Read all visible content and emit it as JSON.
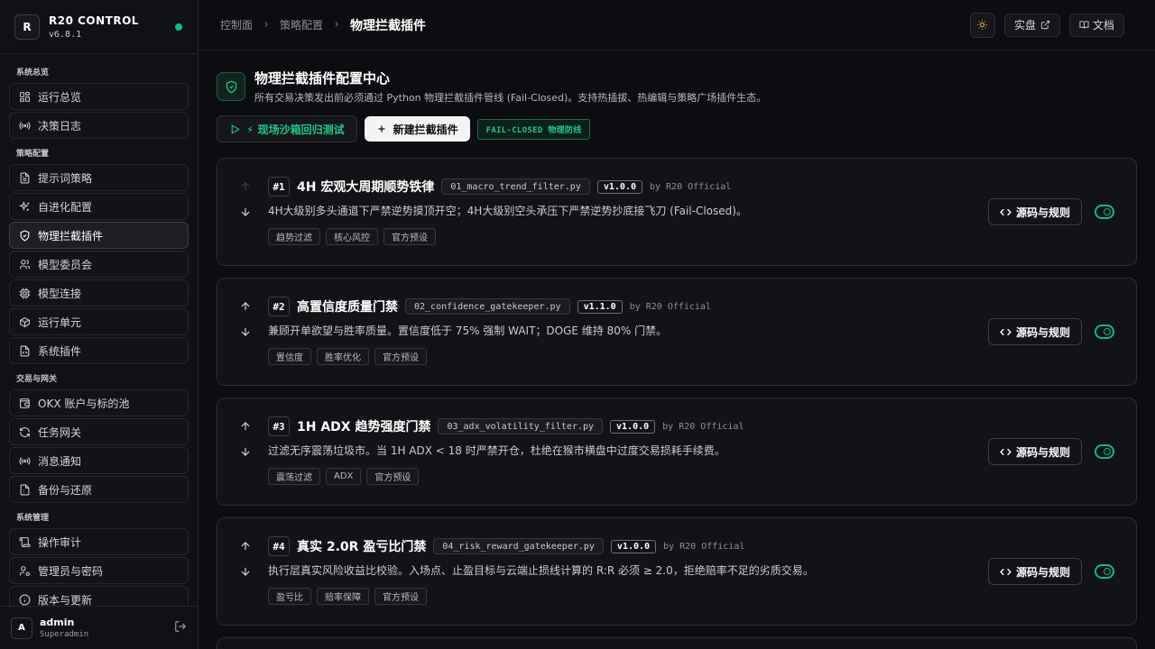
{
  "brand": {
    "logo": "R",
    "title": "R20 CONTROL",
    "version": "v6.8.1",
    "status_color": "#10b981"
  },
  "sidebar": {
    "sections": [
      {
        "title": "系统总览",
        "items": [
          {
            "label": "运行总览",
            "icon": "dashboard-icon"
          },
          {
            "label": "决策日志",
            "icon": "broadcast-icon"
          }
        ]
      },
      {
        "title": "策略配置",
        "items": [
          {
            "label": "提示词策略",
            "icon": "document-icon"
          },
          {
            "label": "自进化配置",
            "icon": "sparkles-icon"
          },
          {
            "label": "物理拦截插件",
            "icon": "shield-icon",
            "active": true
          },
          {
            "label": "模型委员会",
            "icon": "users-icon"
          },
          {
            "label": "模型连接",
            "icon": "cpu-icon"
          },
          {
            "label": "运行单元",
            "icon": "box-icon"
          },
          {
            "label": "系统插件",
            "icon": "file-code-icon"
          }
        ]
      },
      {
        "title": "交易与网关",
        "items": [
          {
            "label": "OKX 账户与标的池",
            "icon": "wallet-icon"
          },
          {
            "label": "任务网关",
            "icon": "refresh-icon"
          },
          {
            "label": "消息通知",
            "icon": "broadcast-icon"
          },
          {
            "label": "备份与还原",
            "icon": "file-archive-icon"
          }
        ]
      },
      {
        "title": "系统管理",
        "items": [
          {
            "label": "操作审计",
            "icon": "scroll-icon"
          },
          {
            "label": "管理员与密码",
            "icon": "user-gear-icon"
          },
          {
            "label": "版本与更新",
            "icon": "info-icon"
          }
        ]
      }
    ],
    "user": {
      "avatar": "A",
      "name": "admin",
      "role": "Superadmin"
    }
  },
  "header": {
    "breadcrumbs": [
      "控制面",
      "策略配置",
      "物理拦截插件"
    ],
    "live_label": "实盘",
    "docs_label": "文档"
  },
  "page": {
    "title": "物理拦截插件配置中心",
    "subtitle": "所有交易决策发出前必须通过 Python 物理拦截插件管线 (Fail-Closed)。支持热插拔、热编辑与策略广场插件生态。",
    "sandbox_label": "⚡ 现场沙箱回归测试",
    "new_label": "新建拦截插件",
    "badge": "FAIL-CLOSED 物理防线",
    "accent": "#22c587"
  },
  "plugins": [
    {
      "index": "#1",
      "name": "4H 宏观大周期顺势铁律",
      "file": "01_macro_trend_filter.py",
      "version": "v1.0.0",
      "author": "by R20 Official",
      "desc": "4H大级别多头通道下严禁逆势摸顶开空；4H大级别空头承压下严禁逆势抄底接飞刀 (Fail-Closed)。",
      "tags": [
        "趋势过滤",
        "核心风控",
        "官方预设"
      ],
      "source_label": "源码与规则",
      "enabled": true
    },
    {
      "index": "#2",
      "name": "高置信度质量门禁",
      "file": "02_confidence_gatekeeper.py",
      "version": "v1.1.0",
      "author": "by R20 Official",
      "desc": "兼顾开单欲望与胜率质量。置信度低于 75% 强制 WAIT；DOGE 维持 80% 门禁。",
      "tags": [
        "置信度",
        "胜率优化",
        "官方预设"
      ],
      "source_label": "源码与规则",
      "enabled": true
    },
    {
      "index": "#3",
      "name": "1H ADX 趋势强度门禁",
      "file": "03_adx_volatility_filter.py",
      "version": "v1.0.0",
      "author": "by R20 Official",
      "desc": "过滤无序震荡垃圾市。当 1H ADX < 18 时严禁开仓，杜绝在猴市横盘中过度交易损耗手续费。",
      "tags": [
        "震荡过滤",
        "ADX",
        "官方预设"
      ],
      "source_label": "源码与规则",
      "enabled": true
    },
    {
      "index": "#4",
      "name": "真实 2.0R 盈亏比门禁",
      "file": "04_risk_reward_gatekeeper.py",
      "version": "v1.0.0",
      "author": "by R20 Official",
      "desc": "执行层真实风险收益比校验。入场点、止盈目标与云端止损线计算的 R:R 必须 ≥ 2.0，拒绝赔率不足的劣质交易。",
      "tags": [
        "盈亏比",
        "赔率保障",
        "官方预设"
      ],
      "source_label": "源码与规则",
      "enabled": true
    }
  ]
}
